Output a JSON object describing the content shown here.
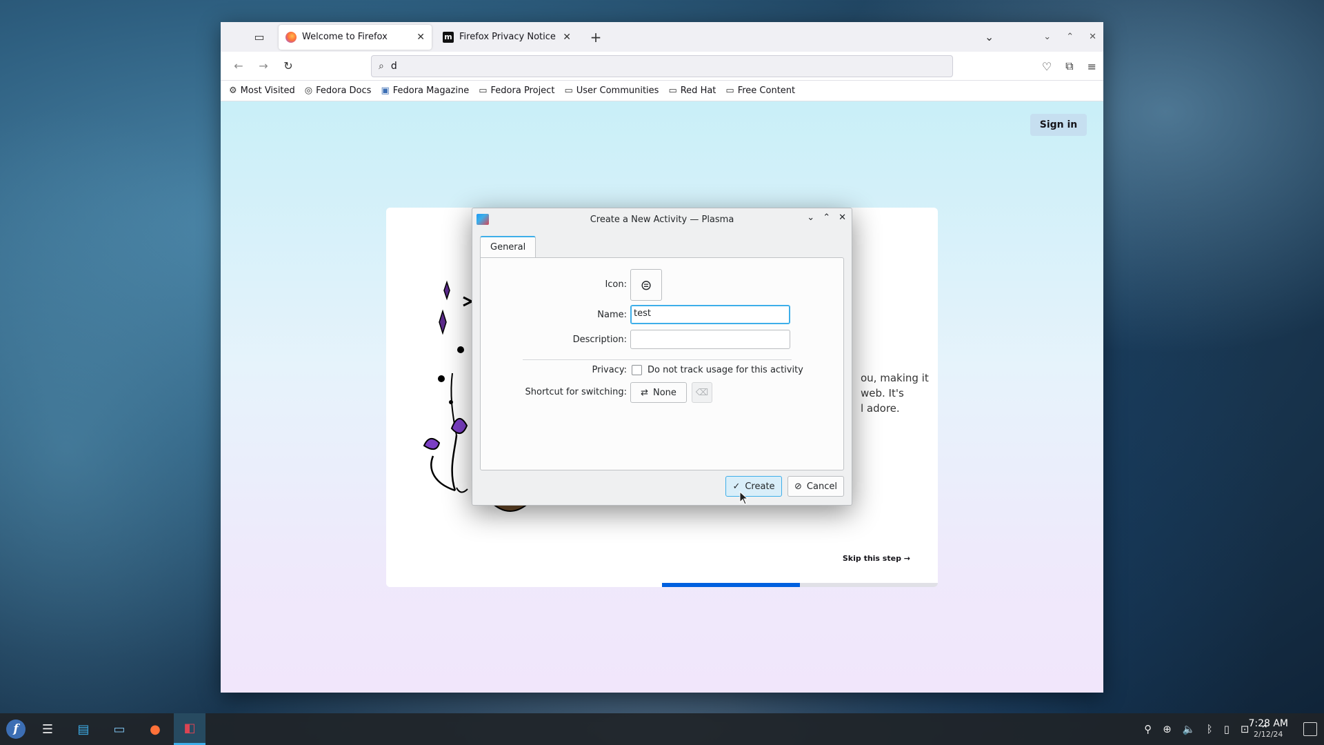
{
  "browser": {
    "tabs": [
      {
        "label": "Welcome to Firefox",
        "active": true
      },
      {
        "label": "Firefox Privacy Notice — Mozilla",
        "active": false
      }
    ],
    "url_value": "d",
    "bookmarks": [
      "Most Visited",
      "Fedora Docs",
      "Fedora Magazine",
      "Fedora Project",
      "User Communities",
      "Red Hat",
      "Free Content"
    ],
    "content": {
      "sign_in": "Sign in",
      "text_lines": [
        "ou, making it",
        "web. It's",
        "l adore."
      ],
      "skip": "Skip this step →",
      "progress": 0.5
    }
  },
  "dialog": {
    "title": "Create a New Activity — Plasma",
    "tab_label": "General",
    "icon_label": "Icon:",
    "name_label": "Name:",
    "name_value": "test",
    "description_label": "Description:",
    "description_value": "",
    "privacy_label": "Privacy:",
    "privacy_checkbox_label": "Do not track usage for this activity",
    "privacy_checked": false,
    "shortcut_label": "Shortcut for switching:",
    "shortcut_value": "None",
    "create_label": "Create",
    "cancel_label": "Cancel"
  },
  "taskbar": {
    "time": "7:28 AM",
    "date": "2/12/24"
  },
  "colors": {
    "accent": "#3daee9",
    "firefox_blue": "#0060df"
  }
}
